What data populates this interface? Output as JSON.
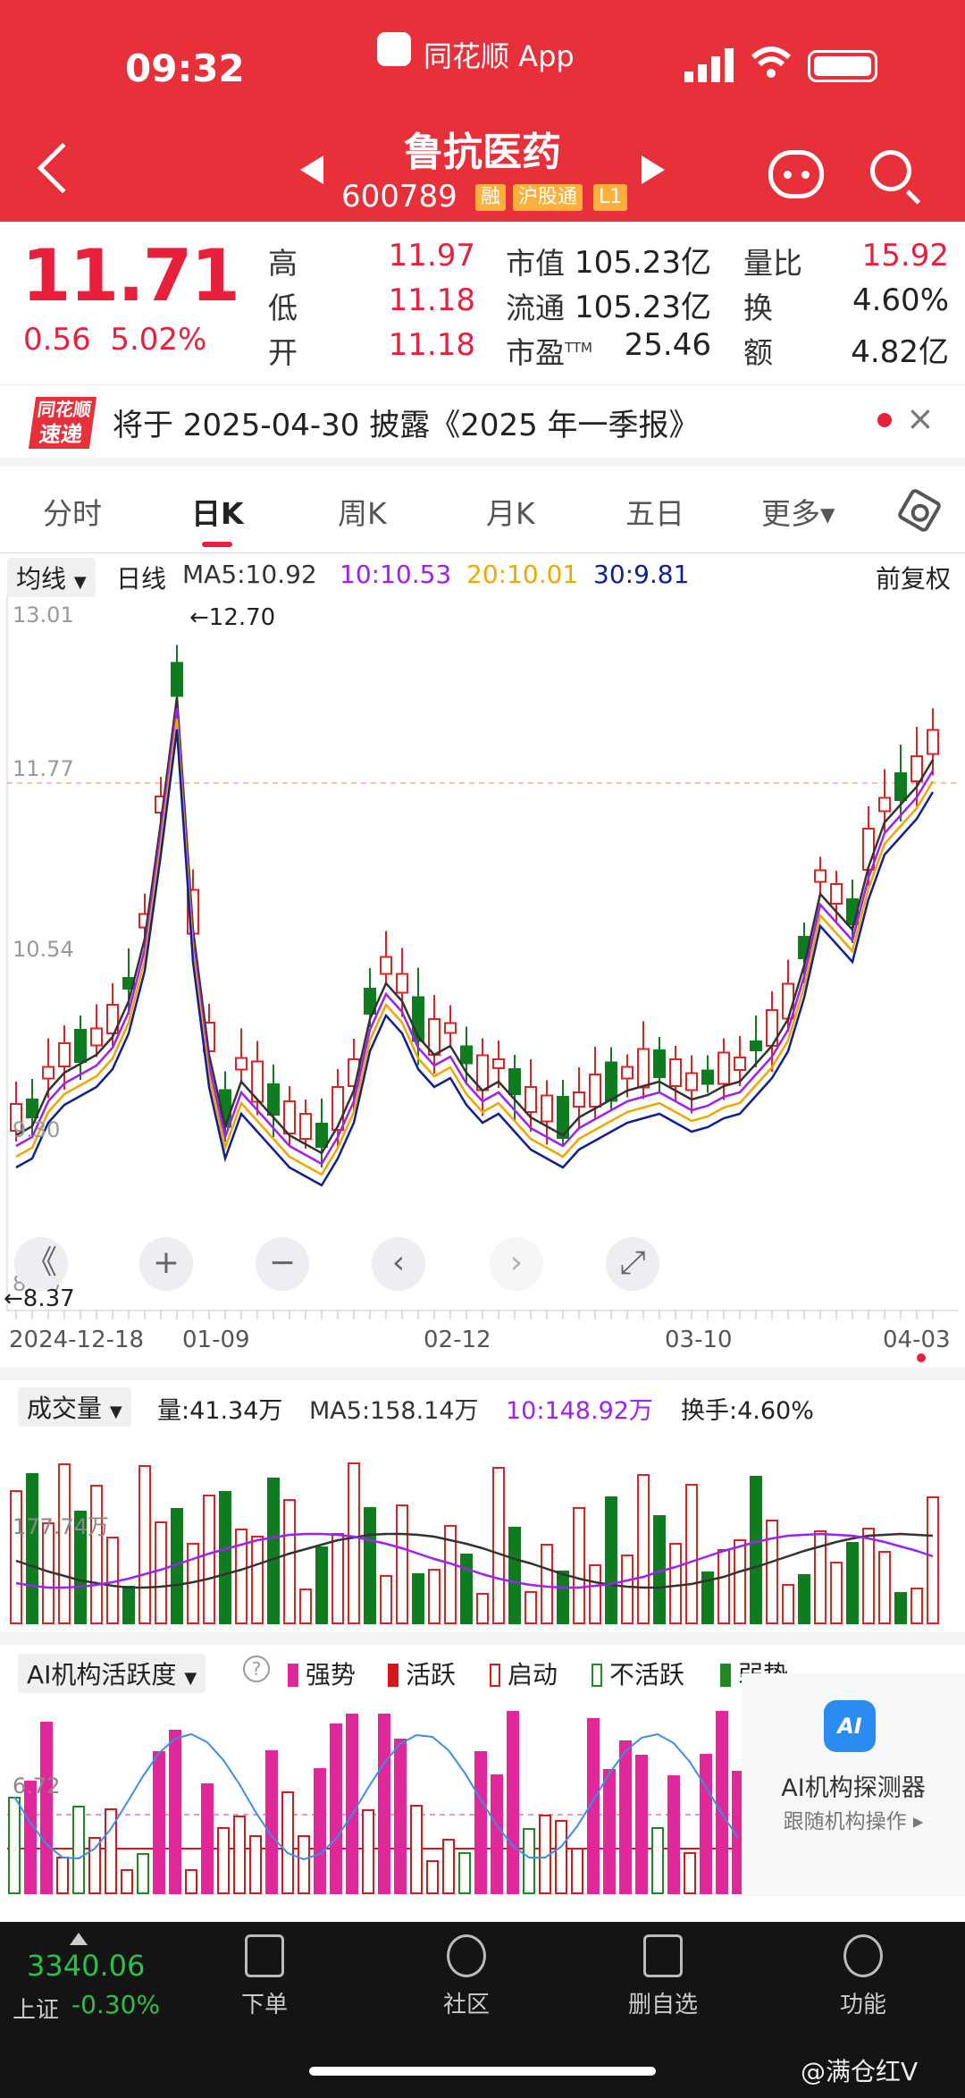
{
  "status_bar": {
    "time": "09:32",
    "app": "同花顺 App"
  },
  "header": {
    "stock_name": "鲁抗医药",
    "stock_code": "600789",
    "tags": [
      "融",
      "沪股通",
      "L1"
    ]
  },
  "quote": {
    "price": "11.71",
    "change": "0.56",
    "change_pct": "5.02%",
    "fields": [
      {
        "label": "高",
        "value": "11.97",
        "color": "red"
      },
      {
        "label": "低",
        "value": "11.18",
        "color": "red"
      },
      {
        "label": "开",
        "value": "11.18",
        "color": "red"
      },
      {
        "label": "市值",
        "value": "105.23亿",
        "color": "black"
      },
      {
        "label": "流通",
        "value": "105.23亿",
        "color": "black"
      },
      {
        "label": "市盈",
        "sup": "TTM",
        "value": "25.46",
        "color": "black"
      },
      {
        "label": "量比",
        "value": "15.92",
        "color": "red"
      },
      {
        "label": "换",
        "value": "4.60%",
        "color": "black"
      },
      {
        "label": "额",
        "value": "4.82亿",
        "color": "black"
      }
    ]
  },
  "notice": {
    "logo_top": "同花顺",
    "logo_bottom": "速递",
    "text": "将于 2025-04-30 披露《2025 年一季报》",
    "close": "×"
  },
  "tabs": [
    "分时",
    "日K",
    "周K",
    "月K",
    "五日",
    "更多▾"
  ],
  "ma_row": {
    "indicator": "均线",
    "period": "日线",
    "ma5": "MA5:10.92",
    "ma10": "10:10.53",
    "ma20": "20:10.01",
    "ma30": "30:9.81",
    "adjust": "前复权",
    "colors": {
      "ma5": "#333333",
      "ma10": "#a020f0",
      "ma20": "#f0a800",
      "ma30": "#102090"
    }
  },
  "kline": {
    "y_labels": [
      "13.01",
      "11.77",
      "10.54",
      "9.30",
      "8.06"
    ],
    "high_label": "←12.70",
    "low_label": "←8.37",
    "dates": [
      "2024-12-18",
      "01-09",
      "02-12",
      "03-10",
      "04-03"
    ]
  },
  "controls": [
    "《",
    "+",
    "−",
    "‹",
    "›",
    "⤢"
  ],
  "volume": {
    "indicator": "成交量",
    "vol": "量:41.34万",
    "ma5": "MA5:158.14万",
    "ma10": "10:148.92万",
    "turnover": "换手:4.60%",
    "y_label": "177.74万"
  },
  "ai": {
    "indicator": "AI机构活跃度",
    "help": "?",
    "legend": [
      {
        "label": "强势",
        "color": "#e0289a"
      },
      {
        "label": "活跃",
        "color": "#d81818"
      },
      {
        "label": "启动",
        "color": "#d81818"
      },
      {
        "label": "不活跃",
        "color": "#1f8a1f"
      },
      {
        "label": "弱势",
        "color": "#1f8a1f"
      }
    ],
    "y_label": "6.72",
    "panel_title": "AI机构探测器",
    "panel_sub": "跟随机构操作 ▸",
    "panel_icon": "AI"
  },
  "bottom": {
    "index_value": "3340.06",
    "index_name": "上证",
    "index_change": "-0.30%",
    "nav": [
      "下单",
      "社区",
      "删自选",
      "功能"
    ]
  },
  "watermark": "@满仓红V"
}
